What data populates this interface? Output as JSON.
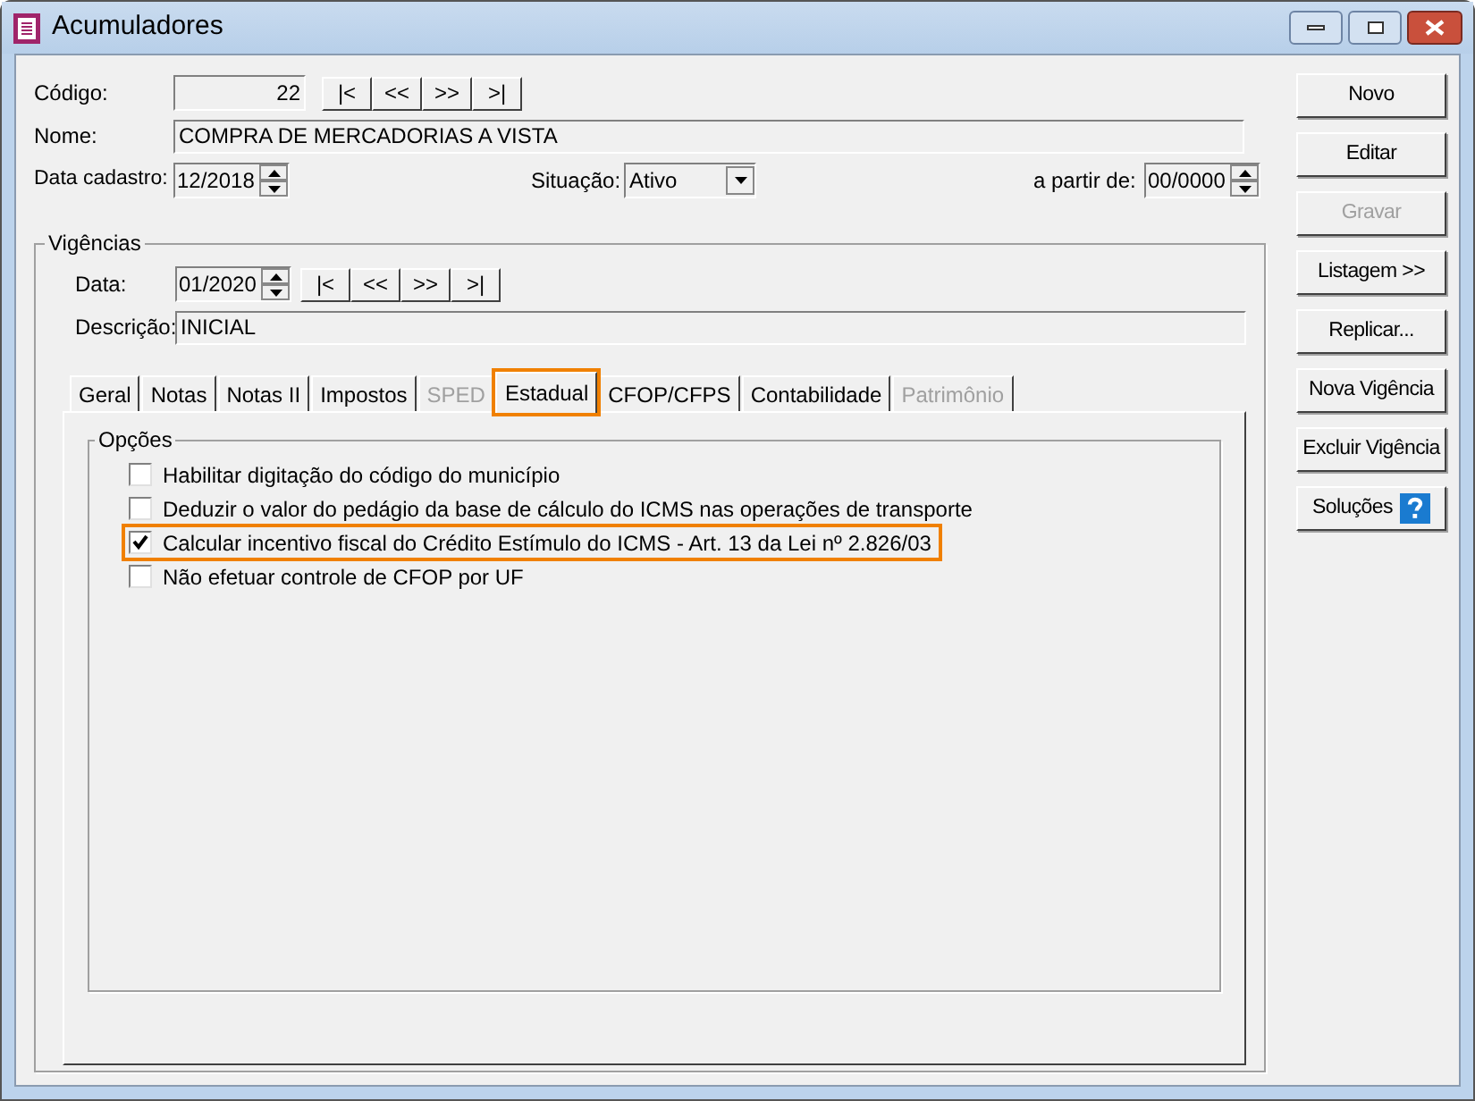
{
  "window": {
    "title": "Acumuladores"
  },
  "codigo": {
    "label": "Código:",
    "value": "22"
  },
  "record_nav": [
    "|<",
    "<<",
    ">>",
    ">|"
  ],
  "nome": {
    "label": "Nome:",
    "value": "COMPRA DE MERCADORIAS A VISTA"
  },
  "data_cadastro": {
    "label": "Data cadastro:",
    "value": "12/2018"
  },
  "situacao": {
    "label": "Situação:",
    "value": "Ativo"
  },
  "a_partir_de": {
    "label": "a partir de:",
    "value": "00/0000"
  },
  "vigencias": {
    "title": "Vigências",
    "data": {
      "label": "Data:",
      "value": "01/2020"
    },
    "nav": [
      "|<",
      "<<",
      ">>",
      ">|"
    ],
    "descricao": {
      "label": "Descrição:",
      "value": "INICIAL"
    }
  },
  "tabs": [
    {
      "label": "Geral",
      "selected": false,
      "disabled": false,
      "highlighted": false
    },
    {
      "label": "Notas",
      "selected": false,
      "disabled": false,
      "highlighted": false
    },
    {
      "label": "Notas II",
      "selected": false,
      "disabled": false,
      "highlighted": false
    },
    {
      "label": "Impostos",
      "selected": false,
      "disabled": false,
      "highlighted": false
    },
    {
      "label": "SPED",
      "selected": false,
      "disabled": true,
      "highlighted": false
    },
    {
      "label": "Estadual",
      "selected": true,
      "disabled": false,
      "highlighted": true
    },
    {
      "label": "CFOP/CFPS",
      "selected": false,
      "disabled": false,
      "highlighted": false
    },
    {
      "label": "Contabilidade",
      "selected": false,
      "disabled": false,
      "highlighted": false
    },
    {
      "label": "Patrimônio",
      "selected": false,
      "disabled": true,
      "highlighted": false
    }
  ],
  "opcoes": {
    "title": "Opções",
    "items": [
      {
        "label": "Habilitar digitação do código do município",
        "checked": false,
        "highlighted": false
      },
      {
        "label": "Deduzir o valor do pedágio da base de cálculo do ICMS nas operações de transporte",
        "checked": false,
        "highlighted": false
      },
      {
        "label": "Calcular incentivo fiscal do Crédito Estímulo do ICMS - Art. 13 da Lei nº 2.826/03",
        "checked": true,
        "highlighted": true
      },
      {
        "label": "Não efetuar controle de CFOP por UF",
        "checked": false,
        "highlighted": false
      }
    ]
  },
  "buttons": [
    {
      "label": "Novo",
      "disabled": false,
      "kind": "plain"
    },
    {
      "label": "Editar",
      "disabled": false,
      "kind": "plain"
    },
    {
      "label": "Gravar",
      "disabled": true,
      "kind": "plain"
    },
    {
      "label": "Listagem >>",
      "disabled": false,
      "kind": "plain"
    },
    {
      "label": "Replicar...",
      "disabled": false,
      "kind": "plain"
    },
    {
      "label": "Nova Vigência",
      "disabled": false,
      "kind": "plain"
    },
    {
      "label": "Excluir Vigência",
      "disabled": false,
      "kind": "plain"
    },
    {
      "label": "Soluções",
      "disabled": false,
      "kind": "help"
    }
  ]
}
